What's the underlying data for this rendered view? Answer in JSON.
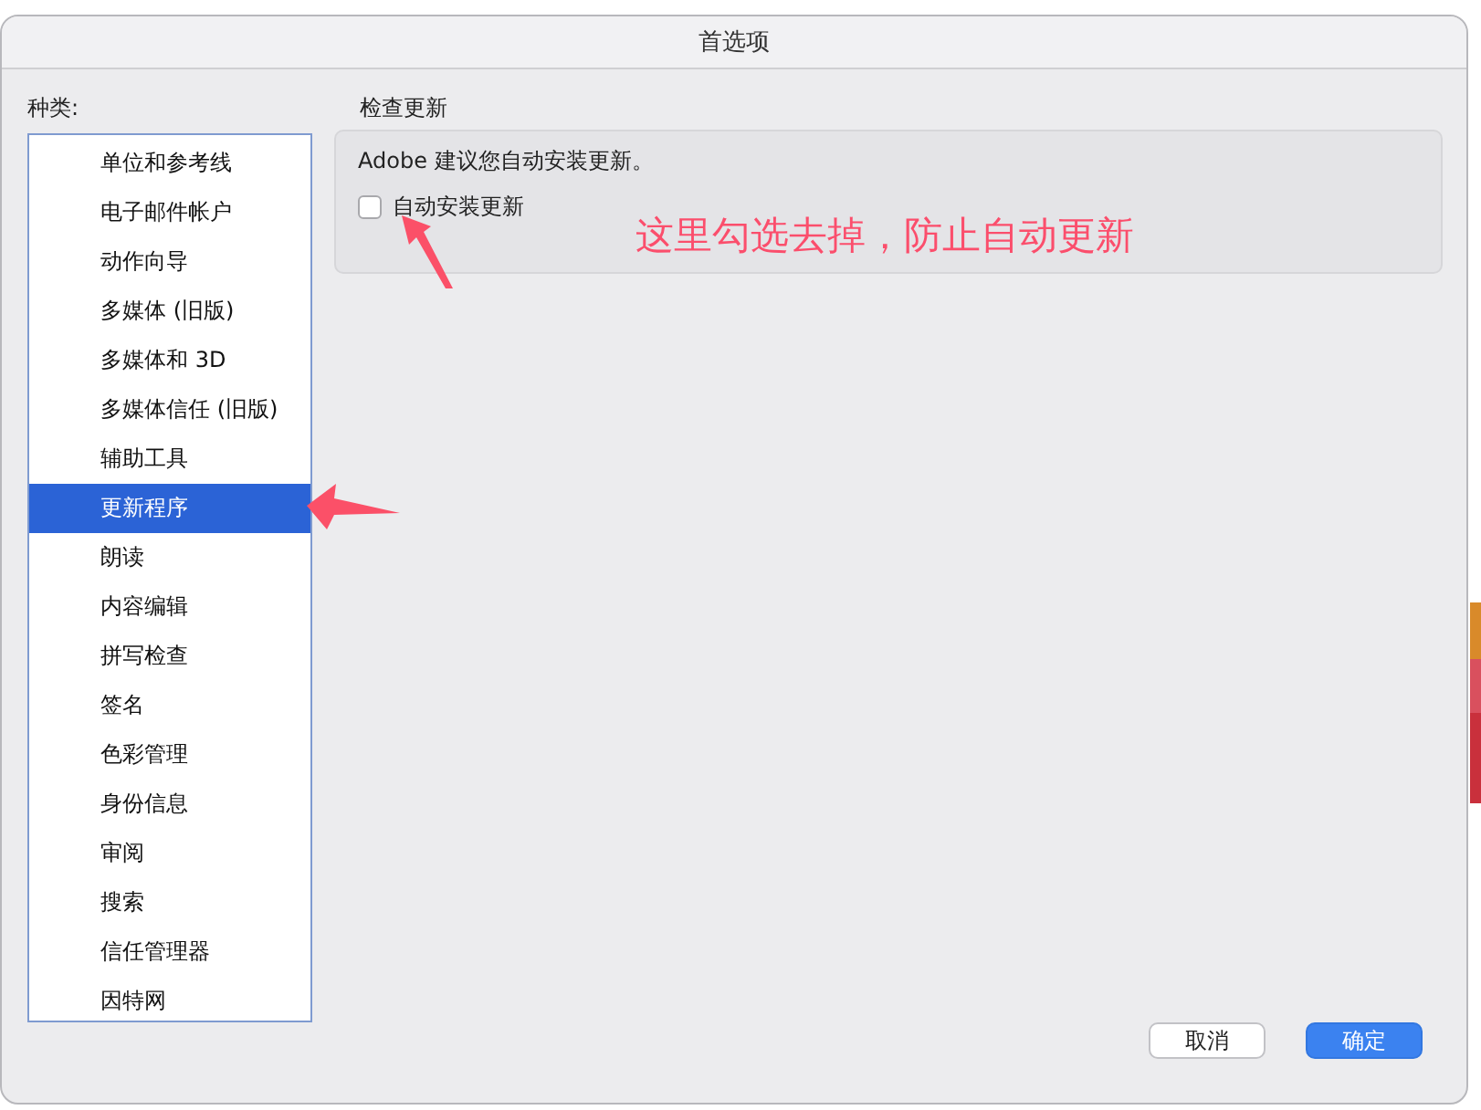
{
  "window": {
    "title": "首选项"
  },
  "categories": {
    "label": "种类:",
    "items": [
      {
        "label": "单位和参考线",
        "selected": false
      },
      {
        "label": "电子邮件帐户",
        "selected": false
      },
      {
        "label": "动作向导",
        "selected": false
      },
      {
        "label": "多媒体 (旧版)",
        "selected": false
      },
      {
        "label": "多媒体和 3D",
        "selected": false
      },
      {
        "label": "多媒体信任 (旧版)",
        "selected": false
      },
      {
        "label": "辅助工具",
        "selected": false
      },
      {
        "label": "更新程序",
        "selected": true
      },
      {
        "label": "朗读",
        "selected": false
      },
      {
        "label": "内容编辑",
        "selected": false
      },
      {
        "label": "拼写检查",
        "selected": false
      },
      {
        "label": "签名",
        "selected": false
      },
      {
        "label": "色彩管理",
        "selected": false
      },
      {
        "label": "身份信息",
        "selected": false
      },
      {
        "label": "审阅",
        "selected": false
      },
      {
        "label": "搜索",
        "selected": false
      },
      {
        "label": "信任管理器",
        "selected": false
      },
      {
        "label": "因特网",
        "selected": false
      }
    ]
  },
  "section": {
    "title": "检查更新",
    "description": "Adobe 建议您自动安装更新。",
    "checkbox": {
      "label": "自动安装更新",
      "checked": false
    }
  },
  "annotation": {
    "text": "这里勾选去掉，防止自动更新"
  },
  "buttons": [
    {
      "label": "取消",
      "kind": "secondary"
    },
    {
      "label": "确定",
      "kind": "primary"
    }
  ]
}
